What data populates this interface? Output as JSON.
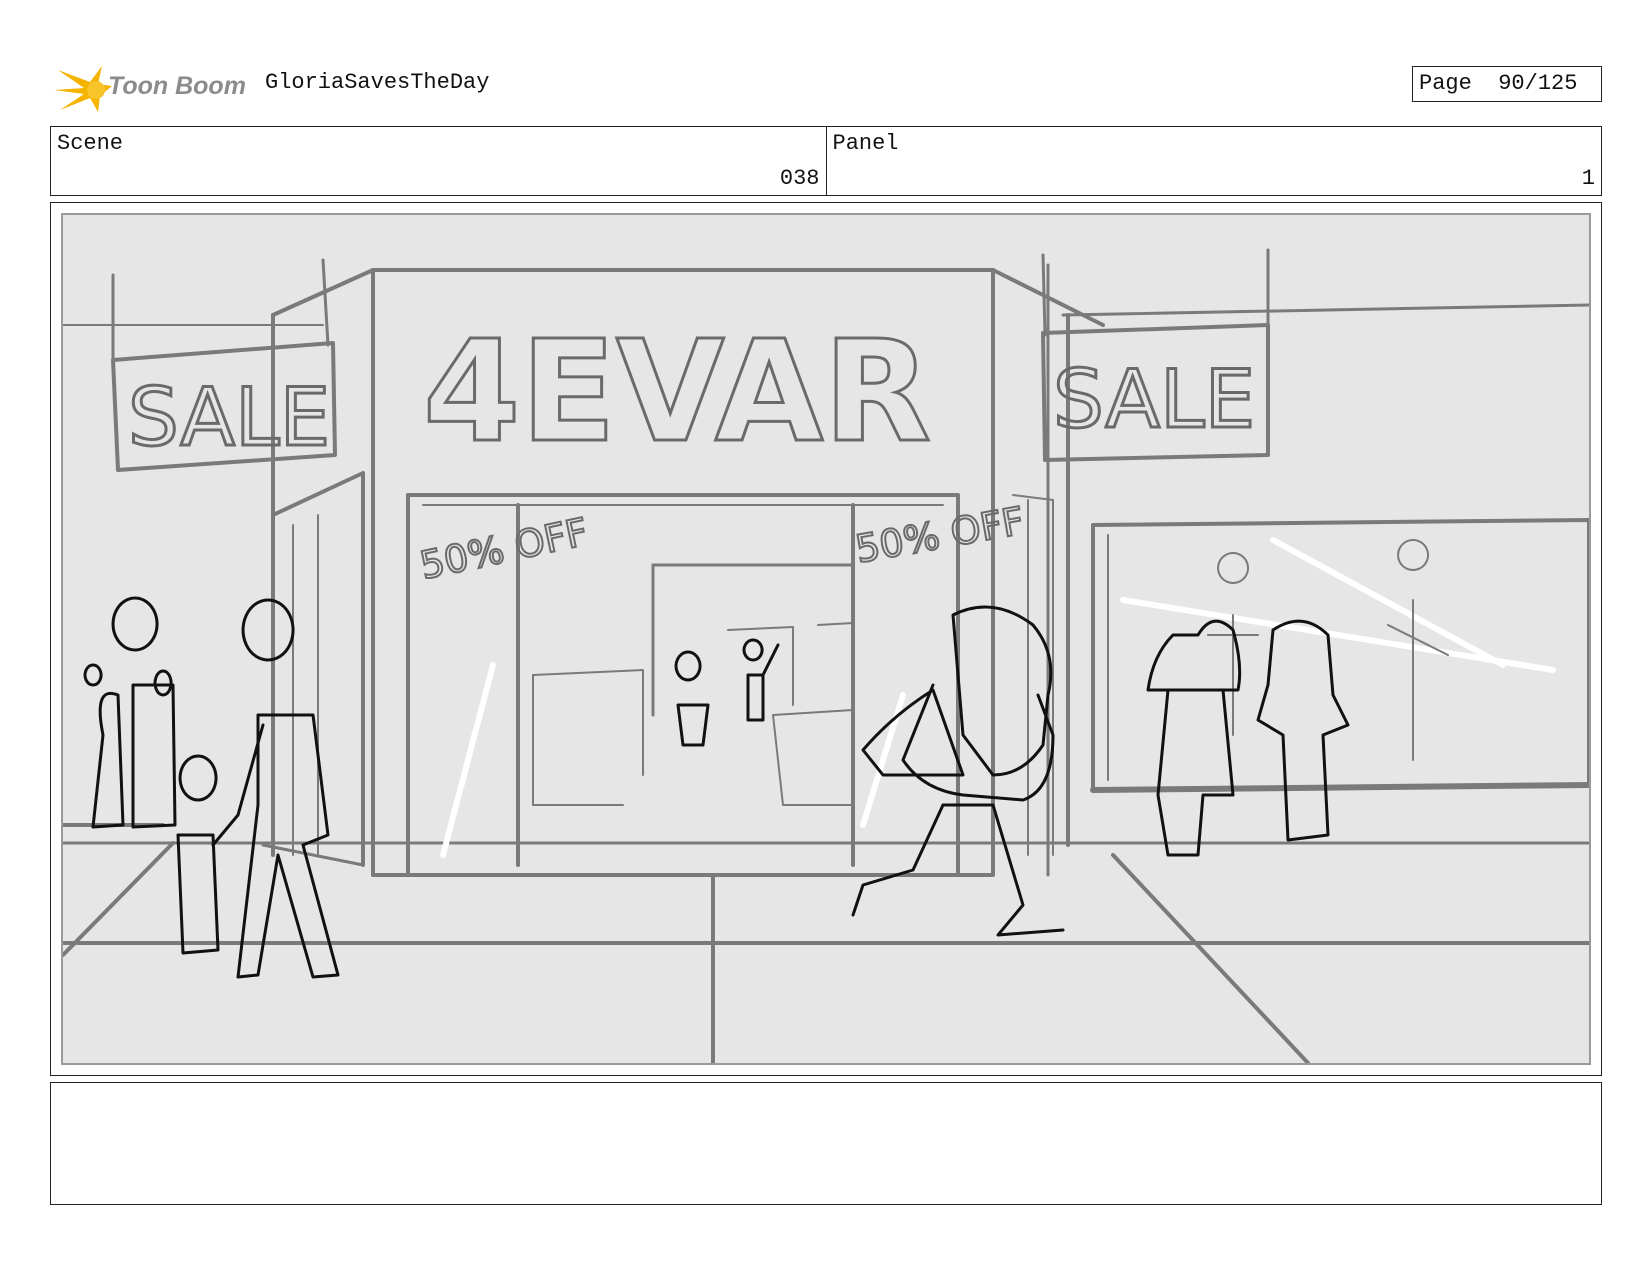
{
  "header": {
    "brand": "Toon Boom",
    "project_name": "GloriaSavesTheDay",
    "page_label": "Page",
    "page_number": "90/125"
  },
  "info": {
    "scene_label": "Scene",
    "scene_value": "038",
    "panel_label": "Panel",
    "panel_value": "1"
  },
  "artwork": {
    "store_sign": "4EVAR",
    "left_sign": "SALE",
    "right_sign": "SALE",
    "left_window_sticker": "50% OFF",
    "right_window_sticker": "50% OFF"
  },
  "notes": {
    "text": ""
  },
  "colors": {
    "logo_yellow": "#f5b400",
    "logo_gray": "#8c8c8c",
    "sketch_gray": "#7a7a7a",
    "sketch_black": "#111111",
    "panel_bg": "#e6e6e6"
  }
}
